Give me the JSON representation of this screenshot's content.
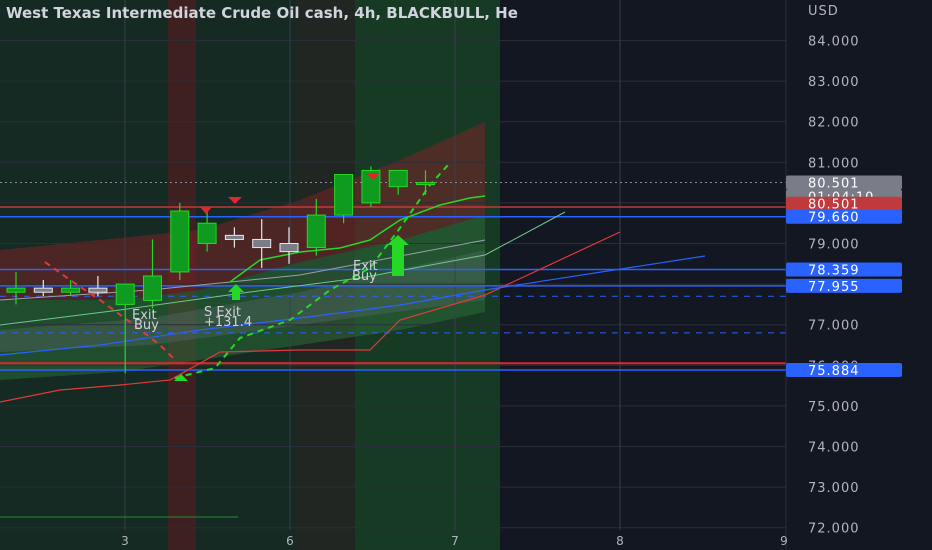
{
  "chart_data": {
    "type": "candlestick",
    "title": "West Texas Intermediate Crude Oil cash, 4h, BLACKBULL, He",
    "currency": "USD",
    "y_ticks": [
      "84.000",
      "83.000",
      "82.000",
      "81.000",
      "80.000",
      "79.000",
      "78.000",
      "77.000",
      "76.000",
      "75.000",
      "74.000",
      "73.000",
      "72.000"
    ],
    "x_ticks": [
      "3",
      "6",
      "7",
      "8",
      "9"
    ],
    "ylim": [
      72,
      84.6
    ],
    "grid": true,
    "candles": [
      {
        "o": 77.8,
        "h": 78.3,
        "l": 77.5,
        "c": 77.9
      },
      {
        "o": 77.9,
        "h": 78.1,
        "l": 77.7,
        "c": 77.8
      },
      {
        "o": 77.8,
        "h": 78.1,
        "l": 77.7,
        "c": 77.9
      },
      {
        "o": 77.9,
        "h": 78.2,
        "l": 77.7,
        "c": 77.8
      },
      {
        "o": 77.5,
        "h": 78.0,
        "l": 75.8,
        "c": 78.0
      },
      {
        "o": 77.6,
        "h": 79.1,
        "l": 77.4,
        "c": 78.2
      },
      {
        "o": 78.3,
        "h": 80.0,
        "l": 78.1,
        "c": 79.8
      },
      {
        "o": 79.0,
        "h": 79.8,
        "l": 78.8,
        "c": 79.5
      },
      {
        "o": 79.2,
        "h": 79.4,
        "l": 78.9,
        "c": 79.1
      },
      {
        "o": 79.1,
        "h": 79.6,
        "l": 78.4,
        "c": 78.9
      },
      {
        "o": 79.0,
        "h": 79.4,
        "l": 78.5,
        "c": 78.8
      },
      {
        "o": 78.9,
        "h": 80.1,
        "l": 78.7,
        "c": 79.7
      },
      {
        "o": 79.7,
        "h": 80.7,
        "l": 79.5,
        "c": 80.7
      },
      {
        "o": 80.0,
        "h": 80.9,
        "l": 79.9,
        "c": 80.8
      },
      {
        "o": 80.4,
        "h": 80.8,
        "l": 80.2,
        "c": 80.8
      },
      {
        "o": 80.5,
        "h": 80.8,
        "l": 80.2,
        "c": 80.5
      }
    ],
    "price_badges": [
      {
        "value": "80.501",
        "color": "#7a7d87"
      },
      {
        "value": "01:04:10",
        "color": "#7a7d87"
      },
      {
        "value": "80.501",
        "color": "#c0393d"
      },
      {
        "value": "79.660",
        "color": "#2962ff"
      },
      {
        "value": "78.359",
        "color": "#2962ff"
      },
      {
        "value": "77.955",
        "color": "#2962ff"
      },
      {
        "value": "75.884",
        "color": "#2962ff"
      }
    ],
    "signals": [
      "S Exit",
      "+131.4",
      "Exit",
      "Buy",
      "Exit",
      "Buy"
    ],
    "colors": {
      "up": "#26d826",
      "down": "#e8e8e8",
      "sma_blue": "#2962ff",
      "red_line": "#e03a3a",
      "background": "#131722"
    }
  }
}
